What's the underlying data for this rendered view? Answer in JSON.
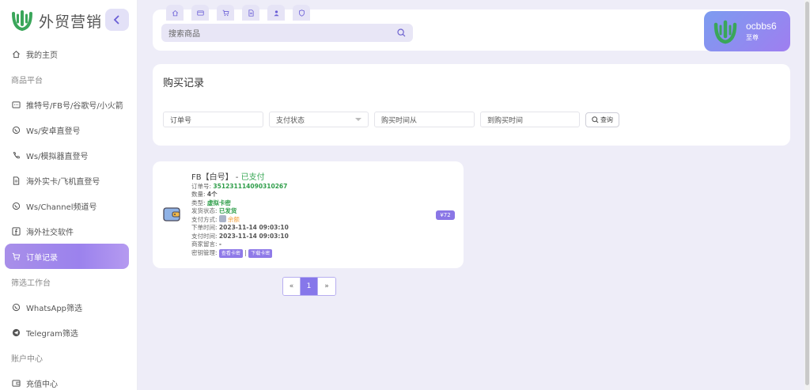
{
  "brand": {
    "name": "外贸营销",
    "color": "#3aa65a"
  },
  "sidebar": {
    "items": [
      {
        "type": "item",
        "label": "我的主页",
        "icon": "home-icon"
      },
      {
        "type": "section",
        "label": "商品平台"
      },
      {
        "type": "item",
        "label": "推特号/FB号/谷歌号/小火箭",
        "icon": "message-icon"
      },
      {
        "type": "item",
        "label": "Ws/安卓直登号",
        "icon": "whatsapp-icon"
      },
      {
        "type": "item",
        "label": "Ws/模拟器直登号",
        "icon": "phone-icon"
      },
      {
        "type": "item",
        "label": "海外实卡/飞机直登号",
        "icon": "document-icon"
      },
      {
        "type": "item",
        "label": "Ws/Channel频道号",
        "icon": "whatsapp-icon"
      },
      {
        "type": "item",
        "label": "海外社交软件",
        "icon": "facebook-icon"
      },
      {
        "type": "item",
        "label": "订单记录",
        "icon": "cart-icon",
        "active": true
      },
      {
        "type": "section",
        "label": "筛选工作台"
      },
      {
        "type": "item",
        "label": "WhatsApp筛选",
        "icon": "whatsapp-icon"
      },
      {
        "type": "item",
        "label": "Telegram筛选",
        "icon": "telegram-icon"
      },
      {
        "type": "section",
        "label": "账户中心"
      },
      {
        "type": "item",
        "label": "充值中心",
        "icon": "wallet-icon"
      }
    ]
  },
  "header": {
    "quick_tabs": [
      "home-icon",
      "card-icon",
      "cart-icon",
      "document-icon",
      "user-icon",
      "shield-icon"
    ],
    "search_placeholder": "搜索商品"
  },
  "user": {
    "name": "ocbbs6",
    "level": "至尊"
  },
  "page": {
    "title": "购买记录"
  },
  "filters": {
    "order_no_placeholder": "订单号",
    "pay_status_label": "支付状态",
    "time_from_placeholder": "购买时间从",
    "time_to_placeholder": "到购买时间",
    "query_label": "查询"
  },
  "order": {
    "product": "FB【白号】",
    "separator": " - ",
    "status": "已支付",
    "order_no_label": "订单号:",
    "order_no": "351231114090310267",
    "quantity_label": "数量:",
    "quantity": "4个",
    "type_label": "类型:",
    "type": "虚拟卡密",
    "ship_label": "发货状态:",
    "ship": "已发货",
    "pay_label": "支付方式:",
    "pay": "余额",
    "order_time_label": "下单时间:",
    "order_time": "2023-11-14 09:03:10",
    "pay_time_label": "支付时间:",
    "pay_time": "2023-11-14 09:03:10",
    "note_label": "商家留言:",
    "note": "-",
    "key_label": "密钥管理:",
    "view_key": "查看卡密",
    "download_key": "下载卡密",
    "key_divider": "|",
    "price": "¥72"
  },
  "pagination": {
    "prev": "«",
    "current": "1",
    "next": "»"
  }
}
